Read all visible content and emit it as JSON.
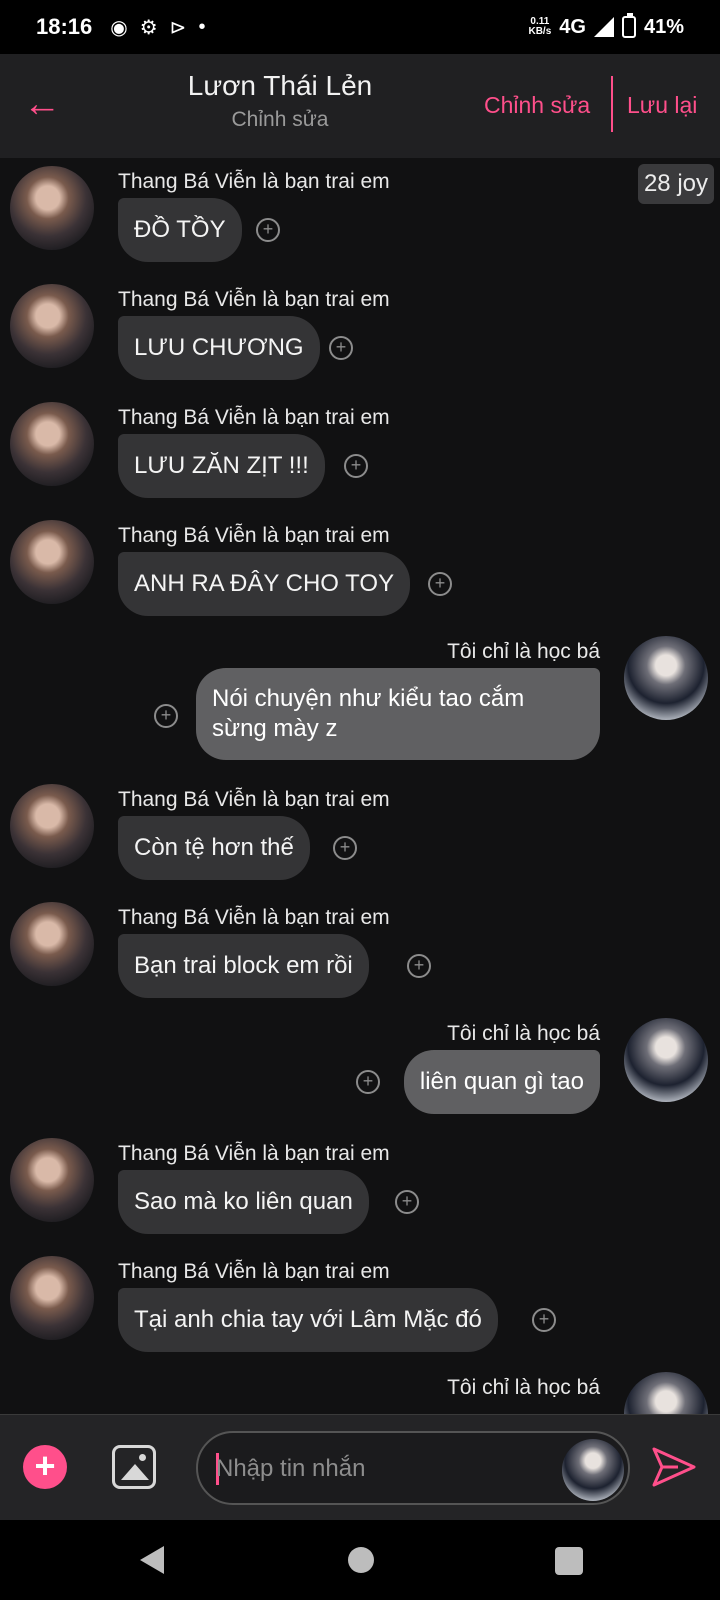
{
  "status_bar": {
    "time": "18:16",
    "net_speed_value": "0.11",
    "net_speed_unit": "KB/s",
    "network": "4G",
    "battery": "41%"
  },
  "header": {
    "title": "Lươn Thái Lẻn",
    "subtitle": "Chỉnh sửa",
    "edit_label": "Chỉnh sửa",
    "save_label": "Lưu lại",
    "accent_color": "#ff4f8b"
  },
  "date_badge": "28 joy",
  "friend_name": "Thang Bá Viễn là bạn trai em",
  "my_name": "Tôi chỉ là học bá",
  "messages": [
    {
      "side": "in",
      "text": "ĐỒ TỒY"
    },
    {
      "side": "in",
      "text": "LƯU CHƯƠNG"
    },
    {
      "side": "in",
      "text": "LƯU ZĂN ZỊT !!!"
    },
    {
      "side": "in",
      "text": "ANH RA ĐÂY CHO TOY"
    },
    {
      "side": "out",
      "text": "Nói chuyện như kiểu tao cắm sừng mày z"
    },
    {
      "side": "in",
      "text": "Còn tệ hơn thế"
    },
    {
      "side": "in",
      "text": "Bạn trai block em rồi"
    },
    {
      "side": "out",
      "text": "liên quan gì tao"
    },
    {
      "side": "in",
      "text": "Sao mà ko liên quan"
    },
    {
      "side": "in",
      "text": "Tại anh chia tay với Lâm Mặc đó"
    }
  ],
  "input": {
    "placeholder": "Nhập tin nhắn"
  },
  "icons": {
    "back": "arrow-left-icon",
    "add": "plus-icon",
    "image": "image-icon",
    "send": "send-icon",
    "react": "add-reaction-icon"
  }
}
